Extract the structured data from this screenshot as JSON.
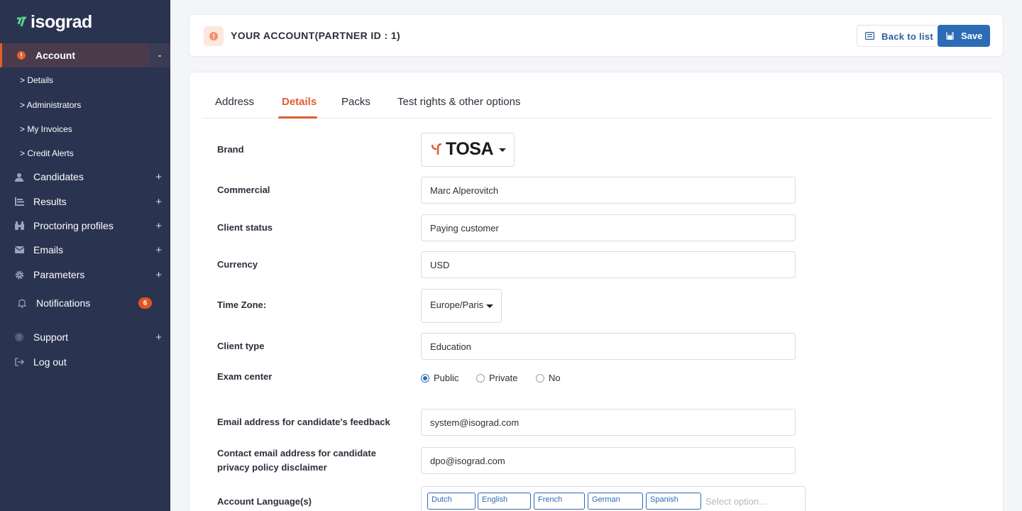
{
  "brand": {
    "logo_text": "isograd",
    "accent": "#e25e2f"
  },
  "sidebar": {
    "account": {
      "label": "Account",
      "toggle": "-"
    },
    "sub_items": [
      "> Details",
      "> Administrators",
      "> My Invoices",
      "> Credit Alerts"
    ],
    "items": [
      {
        "label": "Candidates",
        "toggle": "+"
      },
      {
        "label": "Results",
        "toggle": "+"
      },
      {
        "label": "Proctoring profiles",
        "toggle": "+"
      },
      {
        "label": "Emails",
        "toggle": "+"
      },
      {
        "label": "Parameters",
        "toggle": "+"
      }
    ],
    "notifications": {
      "label": "Notifications",
      "count": "6"
    },
    "support": {
      "label": "Support",
      "toggle": "+"
    },
    "logout": {
      "label": "Log out"
    }
  },
  "header": {
    "title": "YOUR ACCOUNT(PARTNER ID : 1)",
    "back_label": "Back to list",
    "save_label": "Save"
  },
  "tabs": [
    "Address",
    "Details",
    "Packs",
    "Test rights & other options"
  ],
  "active_tab": "Details",
  "form": {
    "brand_label": "Brand",
    "brand_value": "TOSA",
    "commercial_label": "Commercial",
    "commercial_value": "Marc Alperovitch",
    "client_status_label": "Client status",
    "client_status_value": "Paying customer",
    "currency_label": "Currency",
    "currency_value": "USD",
    "timezone_label": "Time Zone:",
    "timezone_value": "Europe/Paris",
    "client_type_label": "Client type",
    "client_type_value": "Education",
    "exam_center_label": "Exam center",
    "exam_center_options": [
      "Public",
      "Private",
      "No"
    ],
    "exam_center_selected": "Public",
    "feedback_email_label": "Email address for candidate's feedback",
    "feedback_email_value": "system@isograd.com",
    "privacy_email_label": "Contact email address for candidate privacy policy disclaimer",
    "privacy_email_value": "dpo@isograd.com",
    "languages_label": "Account Language(s)",
    "languages": [
      "Dutch",
      "English",
      "French",
      "German",
      "Spanish"
    ],
    "languages_placeholder": "Select option..."
  }
}
